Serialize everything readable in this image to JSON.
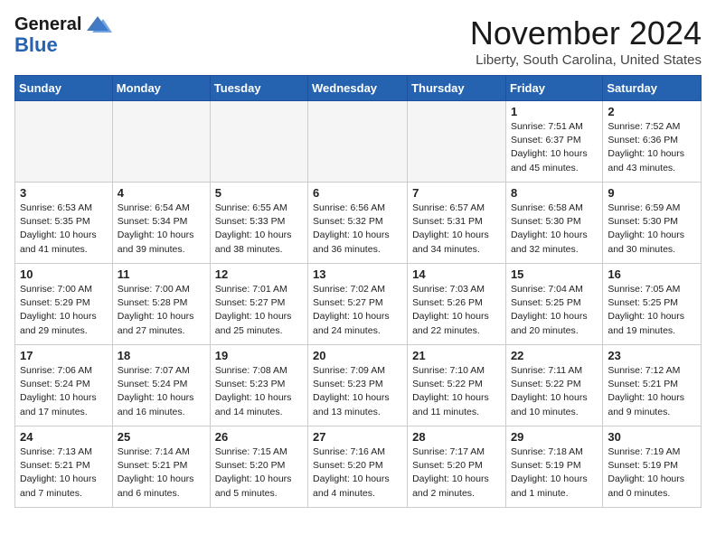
{
  "header": {
    "logo_line1": "General",
    "logo_line2": "Blue",
    "month": "November 2024",
    "location": "Liberty, South Carolina, United States"
  },
  "weekdays": [
    "Sunday",
    "Monday",
    "Tuesday",
    "Wednesday",
    "Thursday",
    "Friday",
    "Saturday"
  ],
  "weeks": [
    [
      {
        "day": "",
        "info": ""
      },
      {
        "day": "",
        "info": ""
      },
      {
        "day": "",
        "info": ""
      },
      {
        "day": "",
        "info": ""
      },
      {
        "day": "",
        "info": ""
      },
      {
        "day": "1",
        "info": "Sunrise: 7:51 AM\nSunset: 6:37 PM\nDaylight: 10 hours\nand 45 minutes."
      },
      {
        "day": "2",
        "info": "Sunrise: 7:52 AM\nSunset: 6:36 PM\nDaylight: 10 hours\nand 43 minutes."
      }
    ],
    [
      {
        "day": "3",
        "info": "Sunrise: 6:53 AM\nSunset: 5:35 PM\nDaylight: 10 hours\nand 41 minutes."
      },
      {
        "day": "4",
        "info": "Sunrise: 6:54 AM\nSunset: 5:34 PM\nDaylight: 10 hours\nand 39 minutes."
      },
      {
        "day": "5",
        "info": "Sunrise: 6:55 AM\nSunset: 5:33 PM\nDaylight: 10 hours\nand 38 minutes."
      },
      {
        "day": "6",
        "info": "Sunrise: 6:56 AM\nSunset: 5:32 PM\nDaylight: 10 hours\nand 36 minutes."
      },
      {
        "day": "7",
        "info": "Sunrise: 6:57 AM\nSunset: 5:31 PM\nDaylight: 10 hours\nand 34 minutes."
      },
      {
        "day": "8",
        "info": "Sunrise: 6:58 AM\nSunset: 5:30 PM\nDaylight: 10 hours\nand 32 minutes."
      },
      {
        "day": "9",
        "info": "Sunrise: 6:59 AM\nSunset: 5:30 PM\nDaylight: 10 hours\nand 30 minutes."
      }
    ],
    [
      {
        "day": "10",
        "info": "Sunrise: 7:00 AM\nSunset: 5:29 PM\nDaylight: 10 hours\nand 29 minutes."
      },
      {
        "day": "11",
        "info": "Sunrise: 7:00 AM\nSunset: 5:28 PM\nDaylight: 10 hours\nand 27 minutes."
      },
      {
        "day": "12",
        "info": "Sunrise: 7:01 AM\nSunset: 5:27 PM\nDaylight: 10 hours\nand 25 minutes."
      },
      {
        "day": "13",
        "info": "Sunrise: 7:02 AM\nSunset: 5:27 PM\nDaylight: 10 hours\nand 24 minutes."
      },
      {
        "day": "14",
        "info": "Sunrise: 7:03 AM\nSunset: 5:26 PM\nDaylight: 10 hours\nand 22 minutes."
      },
      {
        "day": "15",
        "info": "Sunrise: 7:04 AM\nSunset: 5:25 PM\nDaylight: 10 hours\nand 20 minutes."
      },
      {
        "day": "16",
        "info": "Sunrise: 7:05 AM\nSunset: 5:25 PM\nDaylight: 10 hours\nand 19 minutes."
      }
    ],
    [
      {
        "day": "17",
        "info": "Sunrise: 7:06 AM\nSunset: 5:24 PM\nDaylight: 10 hours\nand 17 minutes."
      },
      {
        "day": "18",
        "info": "Sunrise: 7:07 AM\nSunset: 5:24 PM\nDaylight: 10 hours\nand 16 minutes."
      },
      {
        "day": "19",
        "info": "Sunrise: 7:08 AM\nSunset: 5:23 PM\nDaylight: 10 hours\nand 14 minutes."
      },
      {
        "day": "20",
        "info": "Sunrise: 7:09 AM\nSunset: 5:23 PM\nDaylight: 10 hours\nand 13 minutes."
      },
      {
        "day": "21",
        "info": "Sunrise: 7:10 AM\nSunset: 5:22 PM\nDaylight: 10 hours\nand 11 minutes."
      },
      {
        "day": "22",
        "info": "Sunrise: 7:11 AM\nSunset: 5:22 PM\nDaylight: 10 hours\nand 10 minutes."
      },
      {
        "day": "23",
        "info": "Sunrise: 7:12 AM\nSunset: 5:21 PM\nDaylight: 10 hours\nand 9 minutes."
      }
    ],
    [
      {
        "day": "24",
        "info": "Sunrise: 7:13 AM\nSunset: 5:21 PM\nDaylight: 10 hours\nand 7 minutes."
      },
      {
        "day": "25",
        "info": "Sunrise: 7:14 AM\nSunset: 5:21 PM\nDaylight: 10 hours\nand 6 minutes."
      },
      {
        "day": "26",
        "info": "Sunrise: 7:15 AM\nSunset: 5:20 PM\nDaylight: 10 hours\nand 5 minutes."
      },
      {
        "day": "27",
        "info": "Sunrise: 7:16 AM\nSunset: 5:20 PM\nDaylight: 10 hours\nand 4 minutes."
      },
      {
        "day": "28",
        "info": "Sunrise: 7:17 AM\nSunset: 5:20 PM\nDaylight: 10 hours\nand 2 minutes."
      },
      {
        "day": "29",
        "info": "Sunrise: 7:18 AM\nSunset: 5:19 PM\nDaylight: 10 hours\nand 1 minute."
      },
      {
        "day": "30",
        "info": "Sunrise: 7:19 AM\nSunset: 5:19 PM\nDaylight: 10 hours\nand 0 minutes."
      }
    ]
  ]
}
